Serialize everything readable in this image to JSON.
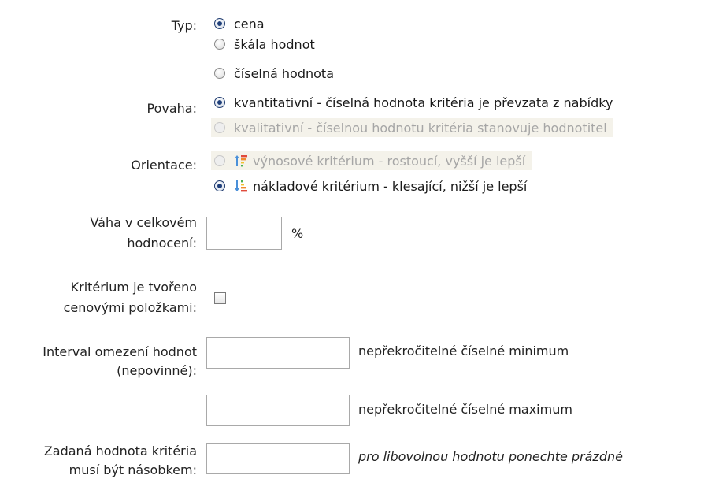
{
  "typ": {
    "label": "Typ:",
    "options": [
      {
        "label": "cena",
        "checked": true
      },
      {
        "label": "škála hodnot",
        "checked": false
      },
      {
        "label": "číselná hodnota",
        "checked": false
      }
    ]
  },
  "povaha": {
    "label": "Povaha:",
    "options": [
      {
        "label": "kvantitativní - číselná hodnota kritéria je převzata z nabídky",
        "checked": true,
        "disabled": false
      },
      {
        "label": "kvalitativní - číselnou hodnotu kritéria stanovuje hodnotitel",
        "checked": false,
        "disabled": true
      }
    ]
  },
  "orientace": {
    "label": "Orientace:",
    "options": [
      {
        "label": "výnosové kritérium - rostoucí, vyšší je lepší",
        "checked": false,
        "disabled": true,
        "icon": "sort-ascending-icon"
      },
      {
        "label": "nákladové kritérium - klesající, nižší je lepší",
        "checked": true,
        "disabled": false,
        "icon": "sort-descending-icon"
      }
    ]
  },
  "vaha": {
    "label_line1": "Váha v celkovém",
    "label_line2": "hodnocení:",
    "value": "",
    "unit": "%"
  },
  "polozky": {
    "label_line1": "Kritérium je tvořeno",
    "label_line2": "cenovými položkami:",
    "checked": false
  },
  "interval": {
    "label_line1": "Interval omezení hodnot",
    "label_line2": "(nepovinné):",
    "min_value": "",
    "min_label": "nepřekročitelné číselné minimum",
    "max_value": "",
    "max_label": "nepřekročitelné číselné maximum"
  },
  "nasobek": {
    "label_line1": "Zadaná hodnota kritéria",
    "label_line2": "musí být násobkem:",
    "value": "",
    "hint": "pro libovolnou hodnotu ponechte prázdné"
  },
  "colors": {
    "radio_checked": "#1f3f7a",
    "disabled_text": "#a6a6a6",
    "disabled_bg": "#f4f2ea",
    "arrow_up": "#e04b3c",
    "arrow_down": "#4a90d9"
  }
}
